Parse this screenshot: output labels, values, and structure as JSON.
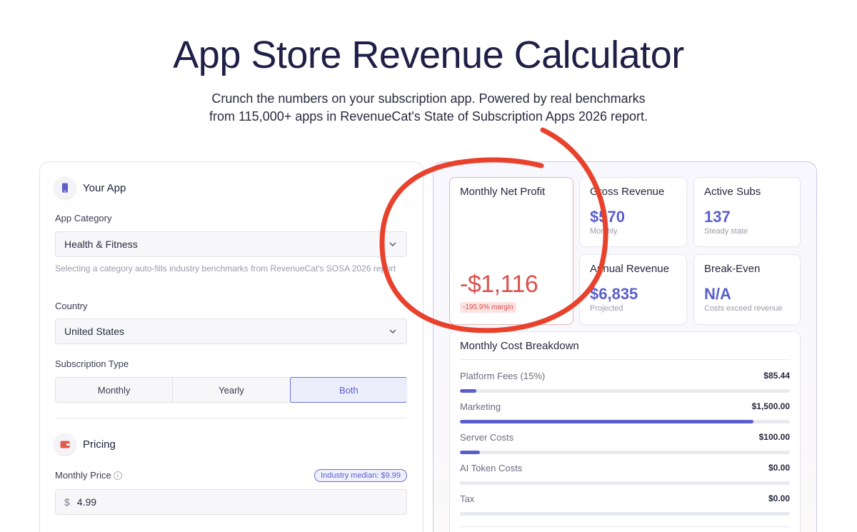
{
  "header": {
    "title": "App Store Revenue Calculator",
    "subtitle_line1": "Crunch the numbers on your subscription app. Powered by real benchmarks",
    "subtitle_line2": "from 115,000+ apps in RevenueCat's State of Subscription Apps 2026 report."
  },
  "left": {
    "your_app_title": "Your App",
    "category_label": "App Category",
    "category_value": "Health & Fitness",
    "category_hint": "Selecting a category auto-fills industry benchmarks from RevenueCat's SOSA 2026 report",
    "country_label": "Country",
    "country_value": "United States",
    "subscription_label": "Subscription Type",
    "subscription_options": [
      "Monthly",
      "Yearly",
      "Both"
    ],
    "subscription_selected": "Both",
    "pricing_title": "Pricing",
    "monthly_price_label": "Monthly Price",
    "monthly_price_badge": "Industry median: $9.99",
    "currency_symbol": "$",
    "monthly_price_value": "4.99"
  },
  "metrics": {
    "net_profit_label": "Monthly Net Profit",
    "net_profit_value": "-$1,116",
    "net_profit_margin": "-195.9% margin",
    "gross_label": "Gross Revenue",
    "gross_value": "$570",
    "gross_sub": "Monthly",
    "subs_label": "Active Subs",
    "subs_value": "137",
    "subs_sub": "Steady state",
    "annual_label": "Annual Revenue",
    "annual_value": "$6,835",
    "annual_sub": "Projected",
    "breakeven_label": "Break-Even",
    "breakeven_value": "N/A",
    "breakeven_sub": "Costs exceed revenue"
  },
  "breakdown": {
    "title": "Monthly Cost Breakdown",
    "rows": [
      {
        "label": "Platform Fees (15%)",
        "amount": "$85.44",
        "fraction": 0.05
      },
      {
        "label": "Marketing",
        "amount": "$1,500.00",
        "fraction": 0.89
      },
      {
        "label": "Server Costs",
        "amount": "$100.00",
        "fraction": 0.06
      },
      {
        "label": "AI Token Costs",
        "amount": "$0.00",
        "fraction": 0
      },
      {
        "label": "Tax",
        "amount": "$0.00",
        "fraction": 0
      }
    ]
  },
  "colors": {
    "accent": "#5a5fcb",
    "negative": "#d9534f",
    "annotation": "#e8412c"
  }
}
